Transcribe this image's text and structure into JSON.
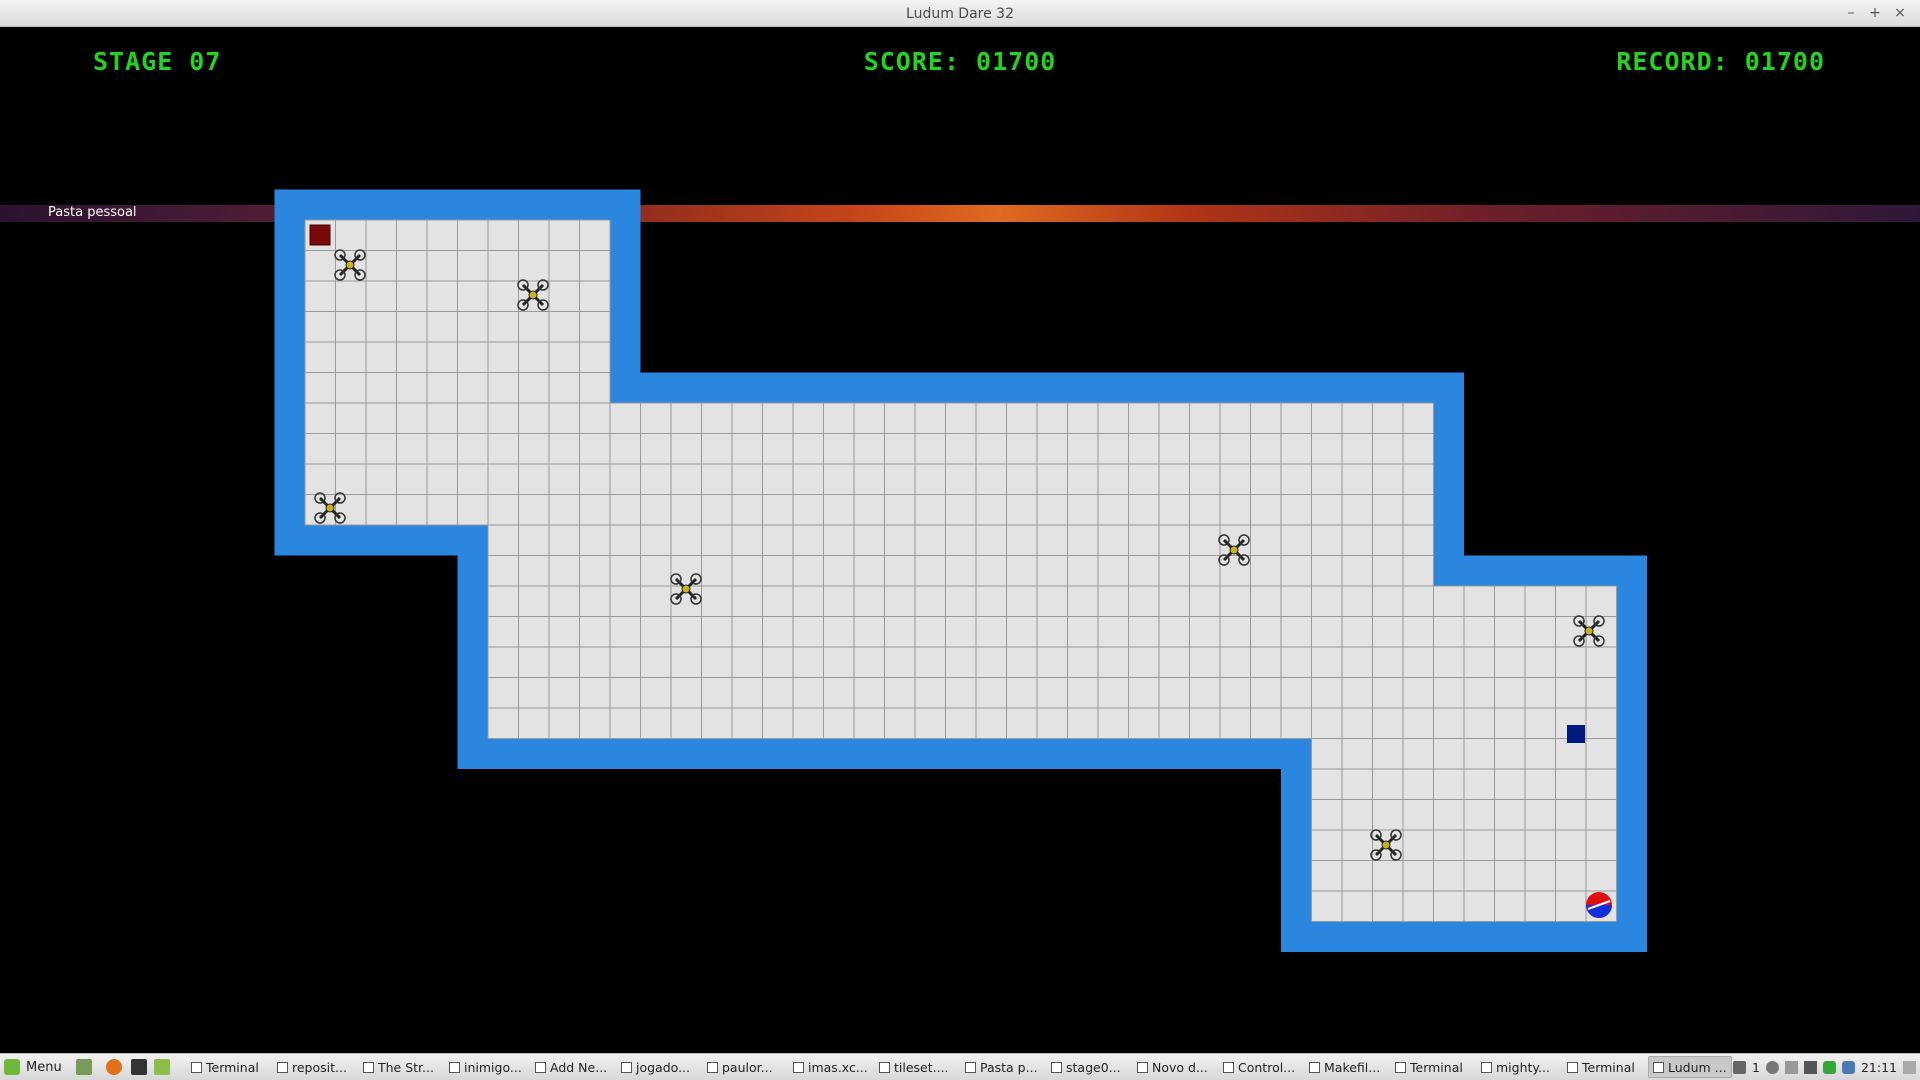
{
  "window": {
    "title": "Ludum Dare 32",
    "controls": {
      "minimize": "–",
      "maximize": "+",
      "close": "×"
    }
  },
  "hud": {
    "stage": "STAGE 07",
    "score": "SCORE: 01700",
    "record": "RECORD: 01700",
    "color": "#22d41f"
  },
  "desktop": {
    "folder_label": "Pasta pessoal"
  },
  "board": {
    "wall_color": "#2b86e0",
    "floor_color": "#e3e3e3",
    "grid_color": "#9a9a9a",
    "player_box_color": "#7a0a0a",
    "goal_box_color": "#001a80",
    "ball_colors": [
      "#e01010",
      "#1030e0"
    ]
  },
  "taskbar": {
    "menu_label": "Menu",
    "tasks": [
      {
        "label": "Terminal",
        "icon": "terminal-icon",
        "active": false
      },
      {
        "label": "reposit...",
        "icon": "folder-icon",
        "active": false
      },
      {
        "label": "The Str...",
        "icon": "bookmark-icon",
        "active": false
      },
      {
        "label": "inimigo...",
        "icon": "image-icon",
        "active": false
      },
      {
        "label": "Add Ne...",
        "icon": "chrome-icon",
        "active": false
      },
      {
        "label": "jogado...",
        "icon": "image-icon",
        "active": false
      },
      {
        "label": "paulor...",
        "icon": "skype-icon",
        "active": false
      },
      {
        "label": "imas.xc...",
        "icon": "image-icon",
        "active": false
      },
      {
        "label": "tileset....",
        "icon": "image-icon",
        "active": false
      },
      {
        "label": "Pasta p...",
        "icon": "folder-icon",
        "active": false
      },
      {
        "label": "stage0...",
        "icon": "grid-icon",
        "active": false
      },
      {
        "label": "Novo d...",
        "icon": "image-icon",
        "active": false
      },
      {
        "label": "Control...",
        "icon": "settings-icon",
        "active": false
      },
      {
        "label": "Makefil...",
        "icon": "text-file-icon",
        "active": false
      },
      {
        "label": "Terminal",
        "icon": "terminal-icon",
        "active": false
      },
      {
        "label": "mighty...",
        "icon": "folder-icon",
        "active": false
      },
      {
        "label": "Terminal",
        "icon": "terminal-icon",
        "active": false
      },
      {
        "label": "Ludum ...",
        "icon": "game-window-icon",
        "active": true
      }
    ],
    "tray": {
      "workspace": "1",
      "time": "21:11"
    }
  }
}
